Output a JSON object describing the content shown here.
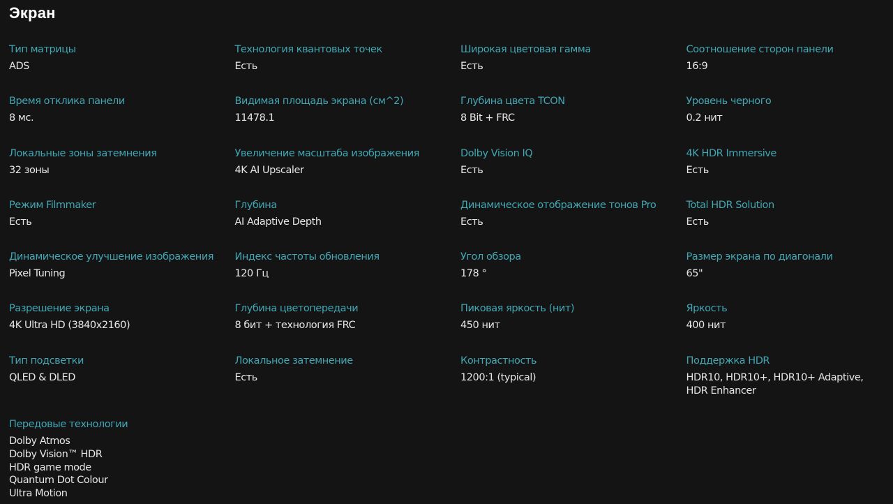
{
  "page": {
    "title": "Экран"
  },
  "specs": [
    [
      {
        "label": "Тип матрицы",
        "value": "ADS"
      },
      {
        "label": "Технология квантовых точек",
        "value": "Есть"
      },
      {
        "label": "Широкая цветовая гамма",
        "value": "Есть"
      },
      {
        "label": "Соотношение сторон панели",
        "value": "16:9"
      }
    ],
    [
      {
        "label": "Время отклика панели",
        "value": "8 мс."
      },
      {
        "label": "Видимая площадь экрана (см^2)",
        "value": "11478.1"
      },
      {
        "label": "Глубина цвета TCON",
        "value": "8 Bit + FRC"
      },
      {
        "label": "Уровень черного",
        "value": "0.2 нит"
      }
    ],
    [
      {
        "label": "Локальные зоны затемнения",
        "value": "32 зоны"
      },
      {
        "label": "Увеличение масштаба изображения",
        "value": "4K AI Upscaler"
      },
      {
        "label": "Dolby Vision IQ",
        "value": "Есть"
      },
      {
        "label": "4K HDR Immersive",
        "value": "Есть"
      }
    ],
    [
      {
        "label": "Режим Filmmaker",
        "value": "Есть"
      },
      {
        "label": "Глубина",
        "value": "AI Adaptive Depth"
      },
      {
        "label": "Динамическое отображение тонов Pro",
        "value": "Есть"
      },
      {
        "label": "Total HDR Solution",
        "value": "Есть"
      }
    ],
    [
      {
        "label": "Динамическое улучшение изображения",
        "value": "Pixel Tuning"
      },
      {
        "label": "Индекс частоты обновления",
        "value": "120 Гц"
      },
      {
        "label": "Угол обзора",
        "value": "178 °"
      },
      {
        "label": "Размер экрана по диагонали",
        "value": "65\""
      }
    ],
    [
      {
        "label": "Разрешение экрана",
        "value": "4K Ultra HD (3840x2160)"
      },
      {
        "label": "Глубина цветопередачи",
        "value": "8 бит + технология FRC"
      },
      {
        "label": "Пиковая яркость (нит)",
        "value": "450 нит"
      },
      {
        "label": "Яркость",
        "value": "400 нит"
      }
    ],
    [
      {
        "label": "Тип подсветки",
        "value": "QLED & DLED"
      },
      {
        "label": "Локальное затемнение",
        "value": "Есть"
      },
      {
        "label": "Контрастность",
        "value": "1200:1 (typical)"
      },
      {
        "label": "Поддержка HDR",
        "value": "HDR10, HDR10+, HDR10+ Adaptive, HDR Enhancer"
      }
    ]
  ],
  "advanced": {
    "label": "Передовые технологии",
    "items": [
      "Dolby Atmos",
      "Dolby Vision™ HDR",
      "HDR game mode",
      "Quantum Dot Colour",
      "Ultra Motion"
    ]
  }
}
